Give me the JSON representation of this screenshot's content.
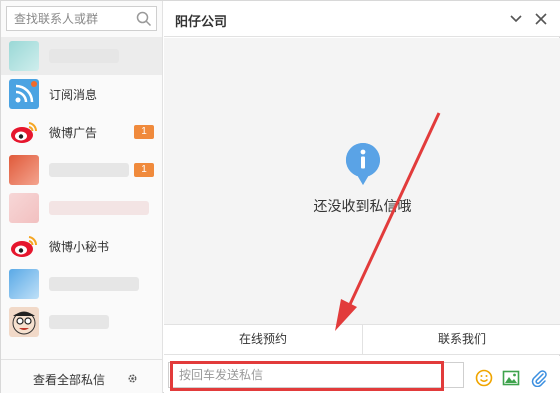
{
  "search": {
    "placeholder": "查找联系人或群",
    "icon": "search-icon"
  },
  "conversations": [
    {
      "kind": "blurred",
      "badge": ""
    },
    {
      "kind": "rss",
      "label": "订阅消息",
      "badge": ""
    },
    {
      "kind": "weibo",
      "label": "微博广告",
      "badge": "1"
    },
    {
      "kind": "blurred",
      "badge": "1"
    },
    {
      "kind": "blurred",
      "badge": ""
    },
    {
      "kind": "weibo",
      "label": "微博小秘书",
      "badge": ""
    },
    {
      "kind": "blurred",
      "badge": ""
    },
    {
      "kind": "blurred",
      "badge": ""
    }
  ],
  "sidebar_footer": {
    "view_all": "查看全部私信",
    "settings_icon": "gear-icon"
  },
  "header": {
    "title": "阳仔公司",
    "collapse_icon": "chevron-down-icon",
    "close_icon": "close-icon"
  },
  "content": {
    "empty_text": "还没收到私信哦",
    "icon": "info-icon"
  },
  "actions": [
    {
      "label": "在线预约"
    },
    {
      "label": "联系我们"
    }
  ],
  "composer": {
    "placeholder": "按回车发送私信",
    "tools": [
      "emoji-icon",
      "image-icon",
      "attachment-icon"
    ]
  },
  "colors": {
    "accent": "#5aa3e6",
    "badge": "#f08a3c",
    "highlight": "#e23b3b"
  }
}
